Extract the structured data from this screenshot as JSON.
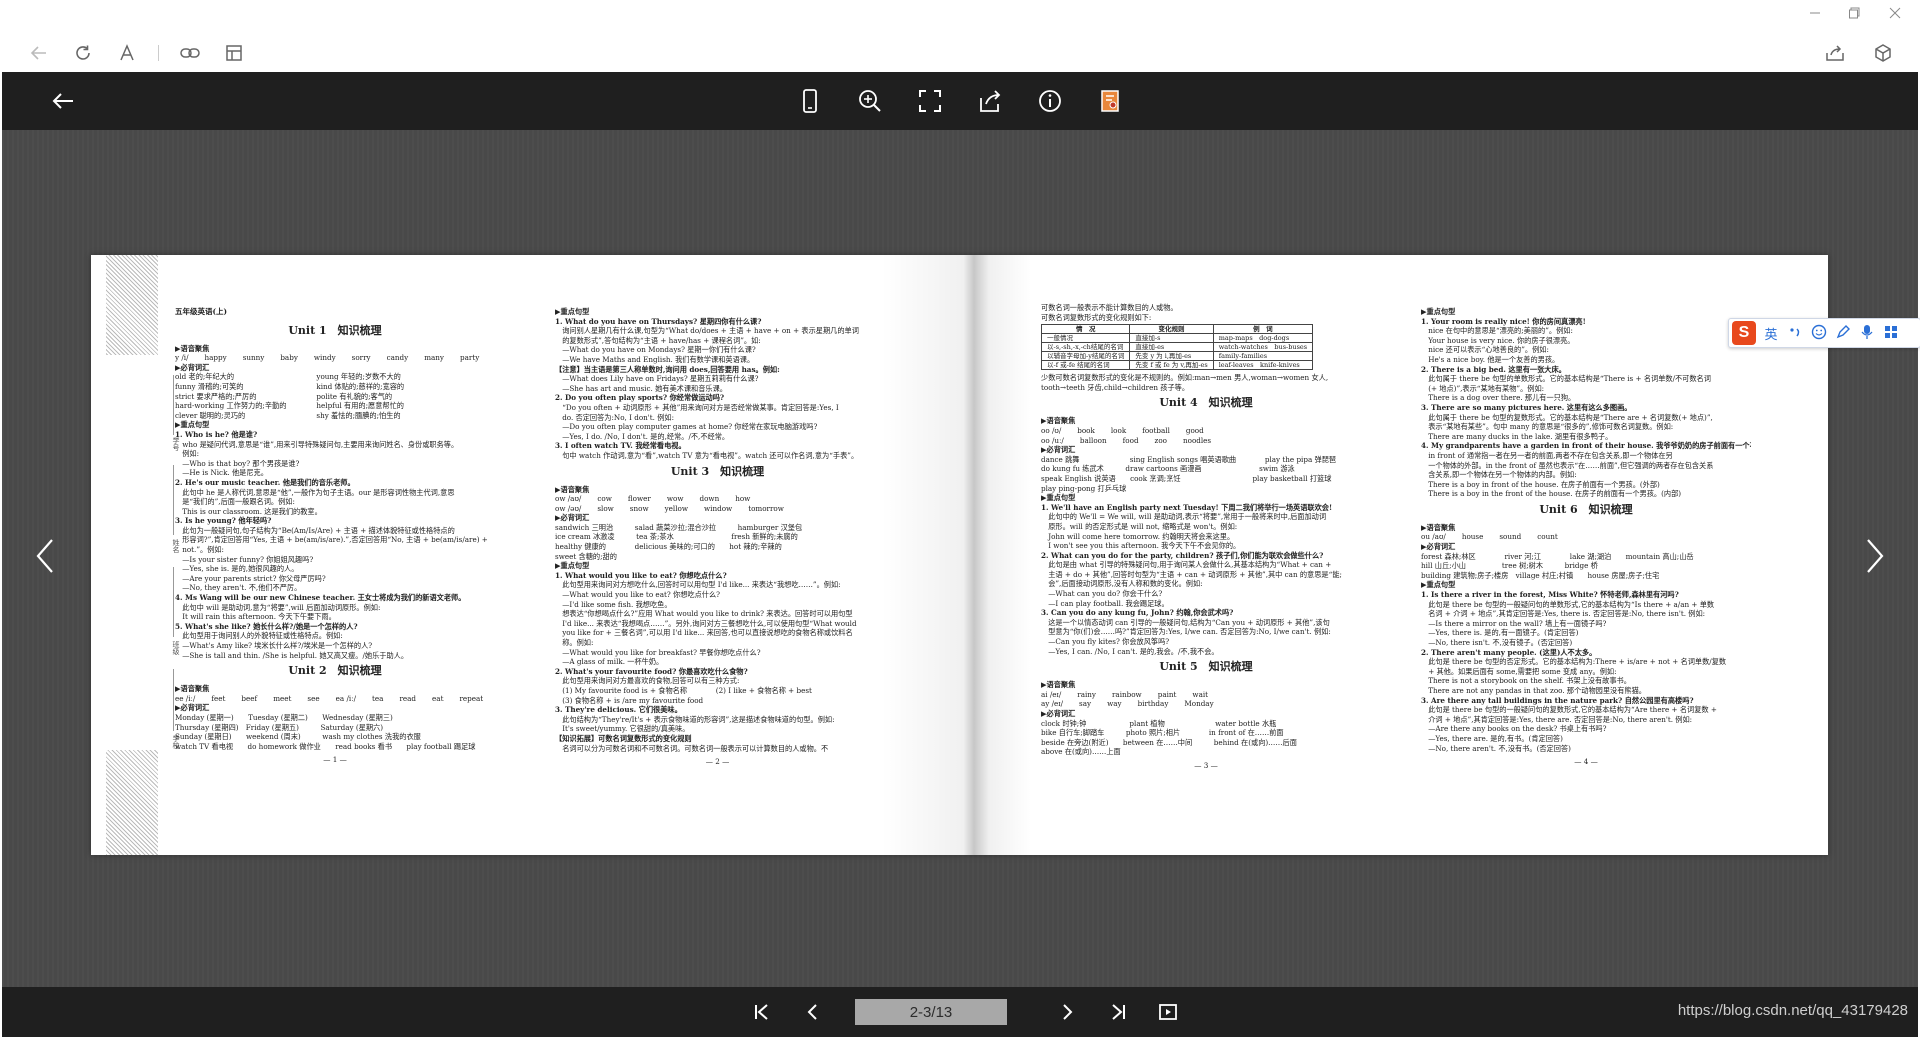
{
  "colors": {
    "reader_bar": "#1f1f1f",
    "reader_bg": "#4a4a4a",
    "page_field": "#a8a8a8",
    "ime_logo": "#e8491d",
    "ime_blue": "#2a6fd6"
  },
  "browser": {
    "icons": [
      "back-icon",
      "refresh-icon",
      "text-icon",
      "link-icon",
      "layout-icon",
      "share-icon",
      "cube-icon"
    ]
  },
  "reader": {
    "page_indicator": "2-3/13",
    "watermark": "https://blog.csdn.net/qq_43179428"
  },
  "ime": {
    "logo": "S",
    "mode": "英"
  },
  "binding": {
    "labels": [
      "学号",
      "姓名",
      "班级",
      "学校"
    ]
  },
  "book": {
    "page1": {
      "book_title": "五年级英语(上)",
      "unit1": "Unit 1　知识梳理",
      "sec_vocab": "▶语音聚焦",
      "vocab_words": [
        "y /i/",
        "happy",
        "sunny",
        "baby",
        "windy",
        "sorry",
        "candy",
        "many",
        "party"
      ],
      "sec_words": "▶必背词汇",
      "words_left": [
        "old 老的;年纪大的",
        "funny 滑稽的;可笑的",
        "strict 要求严格的;严厉的",
        "hard-working 工作努力的;辛勤的",
        "clever 聪明的;灵巧的"
      ],
      "words_right": [
        "young 年轻的;岁数不大的",
        "kind 体贴的;慈祥的;宽容的",
        "polite 有礼貌的;客气的",
        "helpful 有用的;愿意帮忙的",
        "shy 羞怯的;腼腆的;怕生的"
      ],
      "sec_sent": "▶重点句型",
      "lines": [
        "1. Who is he? 他是谁?",
        "　who 是疑问代词,意思是“谁”,用来引导特殊疑问句,主要用来询问姓名、身份或职务等。",
        "　例如:",
        "　—Who is that boy? 那个男孩是谁?",
        "　—He is Nick. 他是尼克。",
        "2. He's our music teacher. 他是我们的音乐老师。",
        "　此句中 he 是人称代词,意思是“他”,一般作为句子主语。our 是形容词性物主代词,意思",
        "　是“我们的”,后面一般跟名词。例如:",
        "　This is our classroom. 这是我们的教室。",
        "3. Is he young? 他年轻吗?",
        "　此句为一般疑问句,句子结构为“Be(Am/Is/Are) + 主语 + 描述体貌特征或性格特点的",
        "　形容词?”,肯定回答用“Yes, 主语 + be(am/is/are).”,否定回答用“No, 主语 + be(am/is/are) +",
        "　not.”。例如:",
        "　—Is your sister funny? 你姐姐风趣吗?",
        "　—Yes, she is. 是的,她很风趣的人。",
        "　—Are your parents strict? 你父母严厉吗?",
        "　—No, they aren't. 不,他们不严厉。",
        "4. Ms Wang will be our new Chinese teacher. 王女士将成为我们的新语文老师。",
        "　此句中 will 是助动词,意为“将要”,will 后面加动词原形。例如:",
        "　It will rain this afternoon. 今天下午要下雨。",
        "5. What's she like? 她长什么样?/她是一个怎样的人?",
        "　此句型用于询问别人的外貌特征或性格特点。例如:",
        "　—What's Amy like? 埃米长什么样?/埃米是一个怎样的人?",
        "　—She is tall and thin. /She is helpful. 她又高又瘦。/她乐于助人。"
      ],
      "unit2": "Unit 2　知识梳理",
      "vocab2": [
        "ee /iː/",
        "feet",
        "beef",
        "meet",
        "see",
        "ea /iː/",
        "tea",
        "read",
        "eat",
        "repeat"
      ],
      "words2": [
        "Monday (星期一)　　Tuesday (星期二)　　Wednesday (星期三)",
        "Thursday (星期四)　Friday (星期五)　　　Saturday (星期六)",
        "Sunday (星期日)　　weekend (周末)　　　wash my clothes 洗我的衣服",
        "watch TV 看电视　　do homework 做作业　　read books 看书　　play football 踢足球"
      ],
      "page_no": "— 1 —"
    },
    "page2": {
      "lines": [
        "▶重点句型",
        "1. What do you have on Thursdays? 星期四你有什么课?",
        "　询问别人星期几有什么课,句型为“What do/does + 主语 + have + on + 表示星期几的单词",
        "　的复数形式”,答句结构为“主语 + have/has + 课程名词”。如:",
        "　—What do you have on Mondays? 星期一你们有什么课?",
        "　—We have Maths and English. 我们有数学课和英语课。",
        "【注意】当主语是第三人称单数时,询问用 does,回答要用 has。例如:",
        "　—What does Lily have on Fridays? 星期五莉莉有什么课?",
        "　—She has art and music. 她有美术课和音乐课。",
        "2. Do you often play sports? 你经常做运动吗?",
        "　“Do you often + 动词原形 + 其他”用来询问对方是否经常做某事。肯定回答是:Yes, I",
        "　do. 否定回答为:No, I don't. 例如:",
        "　—Do you often play computer games at home? 你经常在家玩电脑游戏吗?",
        "　—Yes, I do. /No, I don't. 是的,经常。/不,不经常。",
        "3. I often watch TV. 我经常看电视。",
        "　句中 watch 作动词,意为“看”,watch TV 意为“看电视”。watch 还可以作名词,意为“手表”。"
      ],
      "unit3": "Unit 3　知识梳理",
      "sec_vocab": "▶语音聚焦",
      "vocab3": [
        "ow /aʊ/",
        "cow",
        "flower",
        "wow",
        "down",
        "how"
      ],
      "vocab3b": [
        "ow /əʊ/",
        "slow",
        "snow",
        "yellow",
        "window",
        "tomorrow"
      ],
      "sec_words": "▶必背词汇",
      "words3": [
        "sandwich 三明治　　　salad 蔬菜沙拉;混合沙拉　　　hamburger 汉堡包",
        "ice cream 冰激凌　　　tea 茶;茶水　　　　　　　　fresh 新鲜的;未腐的",
        "healthy 健康的　　　　delicious 美味的;可口的　　hot 辣的;辛辣的",
        "sweet 含糖的;甜的"
      ],
      "lines2": [
        "▶重点句型",
        "1. What would you like to eat? 你想吃点什么?",
        "　此句型用来询问对方想吃什么,回答时可以用句型 I'd like... 来表达“我想吃……”。例如:",
        "　—What would you like to eat? 你想吃点什么?",
        "　—I'd like some fish. 我想吃鱼。",
        "　想表达“你想喝点什么?”应用 What would you like to drink? 来表达。回答时可以用句型",
        "　I'd like... 来表达“我想喝点……”。另外,询问对方三餐想吃什么,可以使用句型“What would",
        "　you like for + 三餐名词”,可以用 I'd like... 来回答,也可以直接说想吃的食物名称或饮料名",
        "　称。例如:",
        "　—What would you like for breakfast? 早餐你想吃点什么?",
        "　—A glass of milk. 一杯牛奶。",
        "2. What's your favourite food? 你最喜欢吃什么食物?",
        "　此句型用来询问对方最喜欢的食物,回答可以有三种方式:",
        "　(1) My favourite food is + 食物名称　　　　(2) I like + 食物名称 + best",
        "　(3) 食物名称 + is /are my favourite food",
        "3. They're delicious. 它们很美味。",
        "　此句结构为“They're/It's + 表示食物味道的形容词”,这是描述食物味道的句型。例如:",
        "　It's sweet/yummy. 它很甜的/真美味。",
        "【知识拓展】可数名词复数形式的变化规则",
        "　名词可以分为可数名词和不可数名词。可数名词一般表示可以计算数目的人或物。不"
      ],
      "page_no": "— 2 —"
    },
    "page3": {
      "intro": [
        "可数名词一般表示不能计算数目的人或物。",
        "可数名词复数形式的变化规则如下:"
      ],
      "table_head": [
        "情　况",
        "变化规则",
        "例　词"
      ],
      "table_rows": [
        [
          "一般情况",
          "直接加-s",
          "map-maps　dog-dogs"
        ],
        [
          "以-s,-sh,-x,-ch结尾的名词",
          "直接加-es",
          "watch-watches　bus-buses"
        ],
        [
          "以辅音字母加-y结尾的名词",
          "先变 y 为 i,再加-es",
          "family-families"
        ],
        [
          "以-f 或-fe 结尾的名词",
          "先变 f 或 fe 为 v,再加-es",
          "leaf-leaves　knife-knives"
        ]
      ],
      "outro": [
        "少数可数名词复数形式的变化是不规则的。例如:man→men 男人,woman→women 女人,",
        "tooth→teeth 牙齿,child→children 孩子等。"
      ],
      "unit4": "Unit 4　知识梳理",
      "sec_vocab": "▶语音聚焦",
      "vocab4": [
        "oo /ʊ/",
        "book",
        "look",
        "football",
        "good"
      ],
      "vocab4b": [
        "oo /uː/",
        "balloon",
        "food",
        "zoo",
        "noodles"
      ],
      "sec_words": "▶必背词汇",
      "words4": [
        "dance 跳舞　　　　　　　sing English songs 唱英语歌曲　　　　play the pipa 弹琵琶",
        "do kung fu 练武术　　　draw cartoons 画漫画　　　　　　　　swim 游泳",
        "speak English 说英语　　cook 烹调;烹饪　　　　　　　　　　play basketball 打篮球",
        "play ping-pong 打乒乓球"
      ],
      "lines": [
        "▶重点句型",
        "1. We'll have an English party next Tuesday! 下周二我们将举行一场英语联欢会!",
        "　此句中的 We'll = We will, will 是助动词,表示“将要”,常用于一般将来时中,后面加动词",
        "　原形。will 的否定形式是 will not, 缩略式是 won't。例如:",
        "　John will come here tomorrow. 约翰明天将会来这里。",
        "　I won't see you this afternoon. 我今天下午不会见你的。",
        "2. What can you do for the party, children? 孩子们,你们能为联欢会做些什么?",
        "　此句是由 what 引导的特殊疑问句,用于询问某人会做什么,其基本结构为“What + can +",
        "　主语 + do + 其他”,回答时句型为“主语 + can + 动词原形 + 其他”,其中 can 的意思是“能;",
        "　会”,后面接动词原形,没有人称和数的变化。例如:",
        "　—What can you do? 你会干什么?",
        "　—I can play football. 我会踢足球。",
        "3. Can you do any kung fu, John? 约翰,你会武术吗?",
        "　这是一个以情态动词 can 引导的一般疑问句,结构为“Can you + 动词原形 + 其他”,该句",
        "　型意为“你(们)会……吗?”肯定回答为:Yes, I/we can. 否定回答为:No, I/we can't. 例如:",
        "　—Can you fly kites? 你会放风筝吗?",
        "　—Yes, I can. /No, I can't. 是的,我会。/不,我不会。"
      ],
      "unit5": "Unit 5　知识梳理",
      "vocab5": [
        "ai /eɪ/",
        "rainy",
        "rainbow",
        "paint",
        "wait"
      ],
      "vocab5b": [
        "ay /eɪ/",
        "say",
        "way",
        "birthday",
        "Monday"
      ],
      "words5": [
        "clock 时钟;钟　　　　　　plant 植物　　　　　　　water bottle 水瓶",
        "bike 自行车;脚踏车　　　photo 照片;相片　　　　in front of 在……前面",
        "beside 在旁边(附近)　　between 在……中间　　　behind 在(或向)……后面",
        "above 在(或向)……上面"
      ],
      "page_no": "— 3 —"
    },
    "page4": {
      "lines": [
        "▶重点句型",
        "1. Your room is really nice! 你的房间真漂亮!",
        "　nice 在句中的意思是“漂亮的;美丽的”。例如:",
        "　Your house is very nice. 你的房子很漂亮。",
        "　nice 还可以表示“心地善良的”。例如:",
        "　He's a nice boy. 他是一个友善的男孩。",
        "2. There is a big bed. 这里有一张大床。",
        "　此句属于 there be 句型的单数形式。它的基本结构是“There is + 名词单数/不可数名词",
        "　(+ 地点)”,表示“某地有某物”。例如:",
        "　There is a dog over there. 那儿有一只狗。",
        "3. There are so many pictures here. 这里有这么多图画。",
        "　此句属于 there be 句型的复数形式。它的基本结构是“There are + 名词复数(+ 地点)”,",
        "　表示“某地有某些”。句中 many 的意思是“很多的”,修饰可数名词复数。例如:",
        "　There are many ducks in the lake. 湖里有很多鸭子。",
        "4. My grandparents have a garden in front of their house. 我爷爷奶奶的房子前面有一个花园。",
        "　in front of 通常指一者在另一者的前面,两者不存在包含关系,即一个物体在另",
        "　一个物体的外部。in the front of 虽然也表示“在……前面”,但它强调的两者存在包含关系",
        "　含关系,即一个物体在另一个物体的内部。例如:",
        "　There is a boy in front of the house. 在房子前面有一个男孩。(外部)",
        "　There is a boy in the front of the house. 在房子的前面有一个男孩。(内部)"
      ],
      "unit6": "Unit 6　知识梳理",
      "sec_vocab": "▶语音聚焦",
      "vocab6": [
        "ou /aʊ/",
        "house",
        "sound",
        "count"
      ],
      "sec_words": "▶必背词汇",
      "words6": [
        "forest 森林;林区　　　　river 河;江　　　　lake 湖;湖泊　　mountain 高山;山岳",
        "hill 山丘;小山　　　　　tree 树;树木　　　bridge 桥",
        "building 建筑物;房子;楼房　village 村庄;村镇　　house 房屋;房子;住宅"
      ],
      "lines2": [
        "▶重点句型",
        "1. Is there a river in the forest, Miss White? 怀特老师,森林里有河吗?",
        "　此句是 there be 句型的一般疑问句的单数形式,它的基本结构为“Is there + a/an + 单数",
        "　名词 + 介词 + 地点”,其肯定回答是:Yes, there is. 否定回答是:No, there isn't. 例如:",
        "　—Is there a mirror on the wall? 墙上有一面镜子吗?",
        "　—Yes, there is. 是的,有一面镜子。(肯定回答)",
        "　—No, there isn't. 不,没有镜子。(否定回答)",
        "2. There aren't many people. (这里)人不太多。",
        "　此句是 there be 句型的否定形式。它的基本结构为:There + is/are + not + 名词单数/复数",
        "　+ 其他。如果后面有 some,需要把 some 变成 any。例如:",
        "　There is not a storybook on the shelf. 书架上没有故事书。",
        "　There are not any pandas in that zoo. 那个动物园里没有熊猫。",
        "3. Are there any tall buildings in the nature park? 自然公园里有高楼吗?",
        "　此句是 there be 句型的一般疑问句的复数形式,它的基本结构为“Are there + 名词复数 +",
        "　介词 + 地点”,其肯定回答是:Yes, there are. 否定回答是:No, there aren't. 例如:",
        "　—Are there any books on the desk? 书桌上有书吗?",
        "　—Yes, there are. 是的,有书。(肯定回答)",
        "　—No, there aren't. 不,没有书。(否定回答)"
      ],
      "page_no": "— 4 —"
    }
  }
}
